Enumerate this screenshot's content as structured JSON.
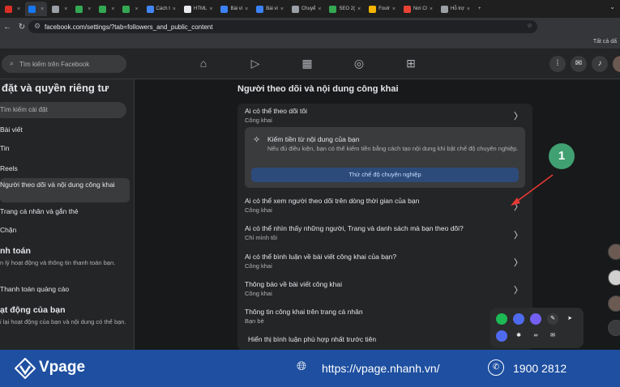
{
  "browser": {
    "tabs": [
      {
        "label": "",
        "color": "#d93025"
      },
      {
        "label": "",
        "color": "#1877f2"
      },
      {
        "label": "",
        "color": "#9aa0a6"
      },
      {
        "label": "",
        "color": "#34a853"
      },
      {
        "label": "",
        "color": "#34a853"
      },
      {
        "label": "",
        "color": "#34a853"
      },
      {
        "label": "Cách t",
        "color": "#4285f4"
      },
      {
        "label": "HTML",
        "color": "#e8eaed"
      },
      {
        "label": "Bài vi",
        "color": "#3b82f6"
      },
      {
        "label": "Bài vi",
        "color": "#3b82f6"
      },
      {
        "label": "Chuyể",
        "color": "#9aa0a6"
      },
      {
        "label": "SEO 2(",
        "color": "#34a853"
      },
      {
        "label": "Foulr",
        "color": "#f4b400"
      },
      {
        "label": "Nơi Cl",
        "color": "#ea4335"
      },
      {
        "label": "Hỗ trợ",
        "color": "#9aa0a6"
      }
    ],
    "new_tab": "+",
    "url": "facebook.com/settings/?tab=followers_and_public_content",
    "bookmarks_label": "Tất cả dấ"
  },
  "fb": {
    "search_placeholder": "Tìm kiếm trên Facebook"
  },
  "sidebar": {
    "title": "đặt và quyền riêng tư",
    "search_placeholder": "Tìm kiếm cài đặt",
    "items": [
      "Bài viết",
      "Tin",
      "Reels",
      "Người theo dõi và nội dung công khai",
      "Trang cá nhân và gắn thẻ",
      "Chặn"
    ],
    "payments_head": "nh toán",
    "payments_desc": "n lý hoạt động và thông tin thanh toán bạn.",
    "payments_item": "Thanh toán quảng cáo",
    "activity_head": "ạt động của bạn",
    "activity_desc": "i lại hoạt động của bạn và nội dung có thể bạn."
  },
  "main": {
    "title": "Người theo dõi và nội dung công khai",
    "rows": [
      {
        "title": "Ai có thể theo dõi tôi",
        "value": "Công khai"
      },
      {
        "title": "Ai có thể xem người theo dõi trên dòng thời gian của bạn",
        "value": "Công khai"
      },
      {
        "title": "Ai có thể nhìn thấy những người, Trang và danh sách mà bạn theo dõi?",
        "value": "Chỉ mình tôi"
      },
      {
        "title": "Ai có thể bình luận về bài viết công khai của bạn?",
        "value": "Công khai"
      },
      {
        "title": "Thông báo về bài viết công khai",
        "value": "Công khai"
      },
      {
        "title": "Thông tin công khai trên trang cá nhân",
        "value": "Bạn bè"
      },
      {
        "title": "Hiển thị bình luận phù hợp nhất trước tiên",
        "value": ""
      }
    ],
    "promo": {
      "title": "Kiếm tiền từ nội dung của bạn",
      "desc": "Nếu đủ điều kiện, bạn có thể kiếm tiền bằng cách tạo nội dung khi bật chế độ chuyên nghiệp.",
      "button": "Thử chế độ chuyên nghiệp"
    }
  },
  "annotation": {
    "badge": "1"
  },
  "footer": {
    "brand": "Vpage",
    "url": "https://vpage.nhanh.vn/",
    "phone": "1900 2812"
  }
}
